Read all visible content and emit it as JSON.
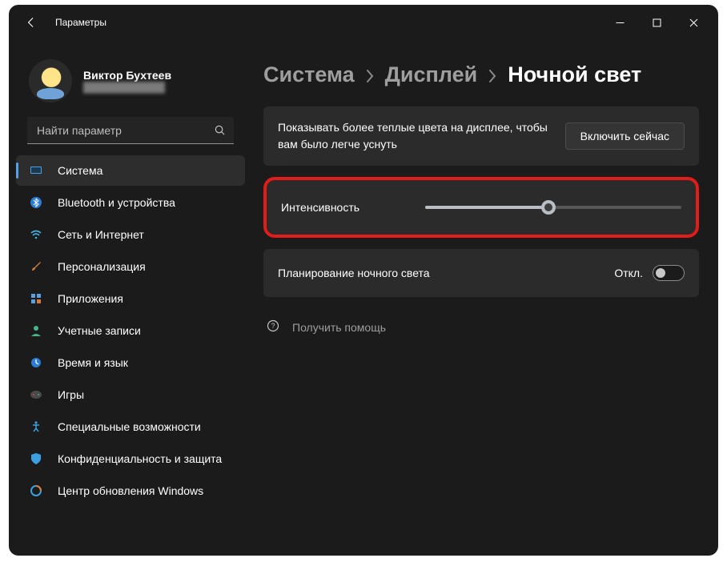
{
  "title": "Параметры",
  "profile": {
    "name": "Виктор Бухтеев"
  },
  "search": {
    "placeholder": "Найти параметр"
  },
  "sidebar": {
    "items": [
      {
        "label": "Система"
      },
      {
        "label": "Bluetooth и устройства"
      },
      {
        "label": "Сеть и Интернет"
      },
      {
        "label": "Персонализация"
      },
      {
        "label": "Приложения"
      },
      {
        "label": "Учетные записи"
      },
      {
        "label": "Время и язык"
      },
      {
        "label": "Игры"
      },
      {
        "label": "Специальные возможности"
      },
      {
        "label": "Конфиденциальность и защита"
      },
      {
        "label": "Центр обновления Windows"
      }
    ]
  },
  "breadcrumbs": {
    "a": "Система",
    "b": "Дисплей",
    "c": "Ночной свет"
  },
  "info_card": {
    "text": "Показывать более теплые цвета на дисплее, чтобы вам было легче уснуть",
    "button": "Включить сейчас"
  },
  "intensity": {
    "label": "Интенсивность",
    "value_percent": 48
  },
  "schedule": {
    "label": "Планирование ночного света",
    "state": "Откл."
  },
  "help": {
    "label": "Получить помощь"
  }
}
